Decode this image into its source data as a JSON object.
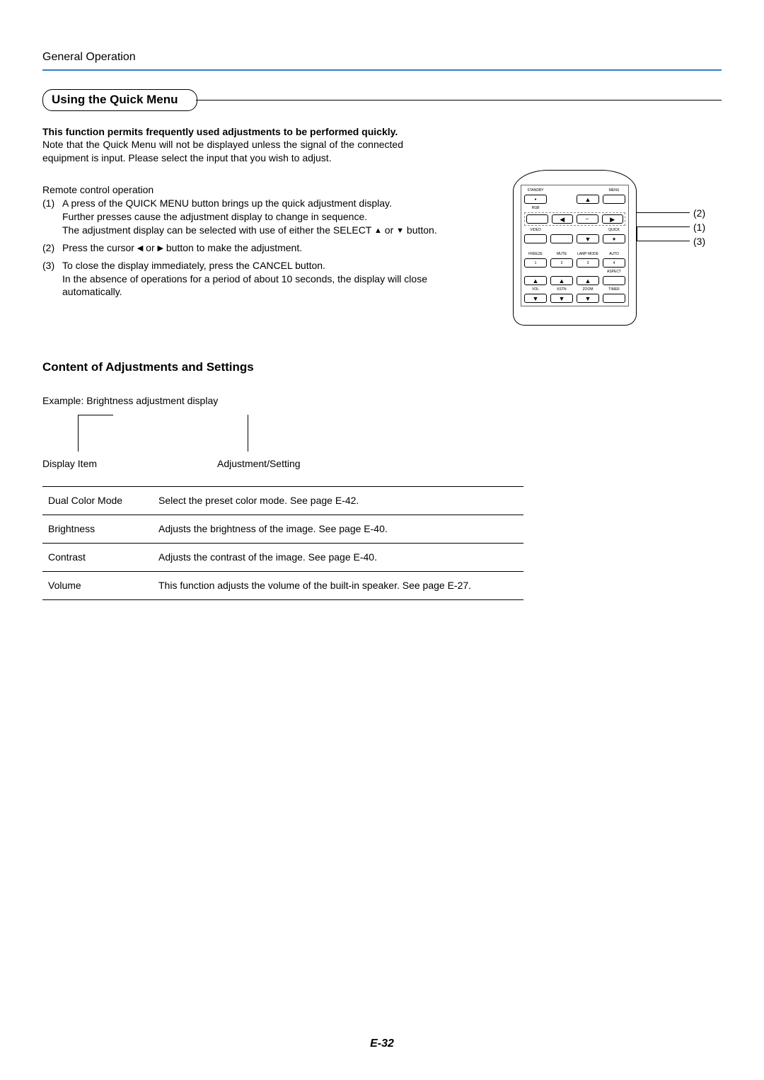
{
  "header": {
    "title": "General Operation"
  },
  "sectionTitle": "Using the Quick Menu",
  "intro": {
    "boldLine": "This function permits frequently used adjustments to be performed quickly.",
    "note": "Note that the Quick Menu will not be displayed unless the signal of the connected equipment is input. Please select the input that you wish to adjust."
  },
  "remoteHeading": "Remote control operation",
  "steps": {
    "s1_num": "(1)",
    "s1a": "A press of the QUICK MENU button brings up the quick adjustment display.",
    "s1b": "Further presses cause the adjustment display to change in sequence.",
    "s1c_prefix": "The adjustment display can be selected with use of either the SELECT ",
    "s1c_suffix": " button.",
    "s2_num": "(2)",
    "s2_prefix": "Press the cursor   ",
    "s2_mid": " or ",
    "s2_suffix": " button to make the adjustment.",
    "s3_num": "(3)",
    "s3a": "To close the display immediately, press the CANCEL button.",
    "s3b": "In the absence of operations for a period of about 10 seconds, the display will close automatically."
  },
  "orText": " or ",
  "subheading": "Content of Adjustments and Settings",
  "exampleLine": "Example: Brightness adjustment display",
  "labels": {
    "displayItem": "Display Item",
    "adjSetting": "Adjustment/Setting"
  },
  "table": [
    {
      "name": "Dual Color Mode",
      "desc": "Select the preset color mode. See page E-42."
    },
    {
      "name": "Brightness",
      "desc": "Adjusts the brightness of the image. See page E-40."
    },
    {
      "name": "Contrast",
      "desc": "Adjusts the contrast of the image. See page E-40."
    },
    {
      "name": "Volume",
      "desc": "This function adjusts the volume of the built-in speaker. See page E-27."
    }
  ],
  "remote": {
    "callouts": {
      "c1": "(2)",
      "c2": "(1)",
      "c3": "(3)"
    },
    "labels": {
      "standby": "STANDBY",
      "menu": "MENU",
      "rgb": "RGB",
      "video": "VIDEO",
      "quick": "QUICK",
      "freeze": "FREEZE",
      "mute": "MUTE",
      "lamp": "LAMP MODE",
      "auto": "AUTO",
      "n1": "1",
      "n2": "2",
      "n3": "3",
      "n4": "4",
      "aspect": "ASPECT",
      "vol": "VOL",
      "kstn": "KSTN",
      "zoom": "ZOOM",
      "timer": "TIMER"
    }
  },
  "pageNumber": "E-32"
}
